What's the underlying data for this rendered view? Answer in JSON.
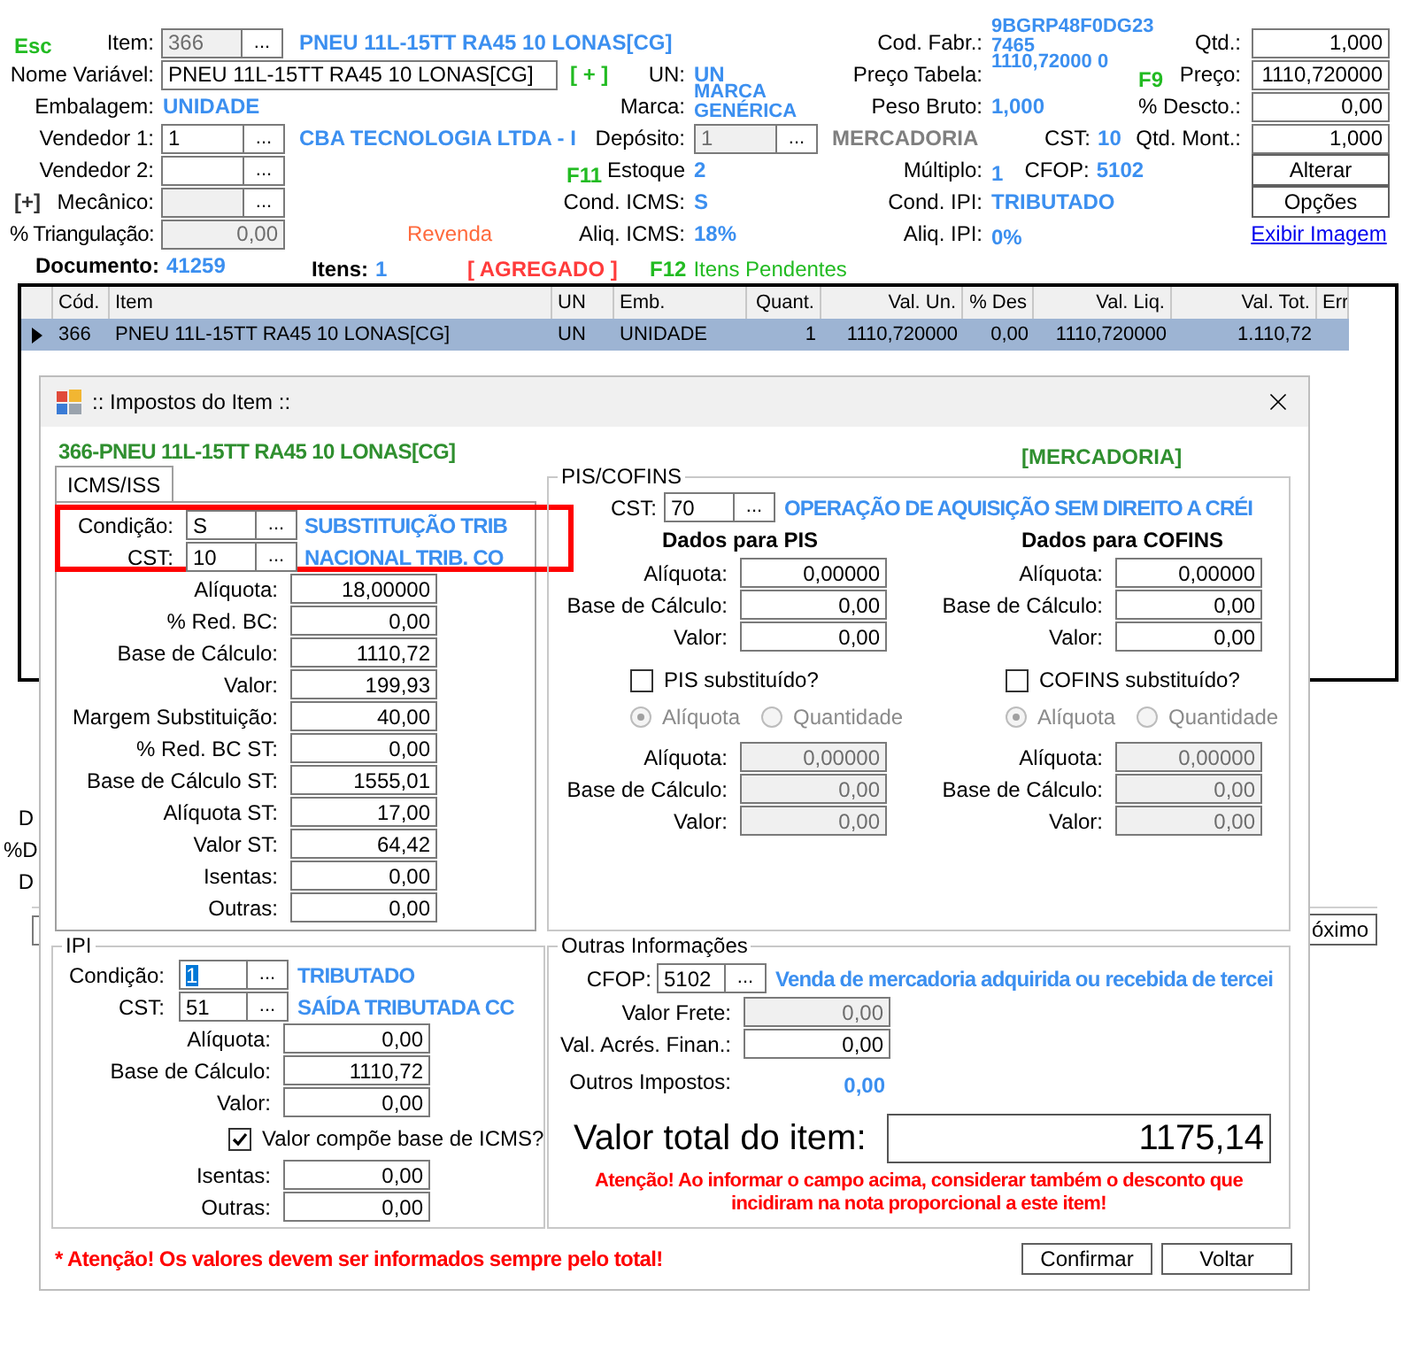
{
  "main": {
    "esc_key": "Esc",
    "item": {
      "label": "Item:",
      "value": "366",
      "button": "...",
      "disabled": true,
      "description": "PNEU 11L-15TT RA45 10 LONAS[CG]"
    },
    "cod_fabr": {
      "label": "Cod. Fabr.:",
      "value": "9BGRP48F0DG23 7465"
    },
    "qtd": {
      "label": "Qtd.:",
      "value": "1,000"
    },
    "nome_variavel": {
      "label": "Nome Variável:",
      "value": "PNEU 11L-15TT RA45 10 LONAS[CG]"
    },
    "plus_key": "[ + ]",
    "un": {
      "label": "UN:",
      "value": "UN"
    },
    "preco_tabela": {
      "label": "Preço Tabela:",
      "value": "1110,72000 0"
    },
    "f9_key": "F9",
    "preco": {
      "label": "Preço:",
      "value": "1110,720000"
    },
    "embalagem": {
      "label": "Embalagem:",
      "value": "UNIDADE"
    },
    "marca": {
      "label": "Marca:",
      "value": "MARCA GENÉRICA"
    },
    "peso_bruto": {
      "label": "Peso Bruto:",
      "value": "1,000"
    },
    "desconto": {
      "label": "% Descto.:",
      "value": "0,00"
    },
    "vendedor_1": {
      "label": "Vendedor 1:",
      "value": "1",
      "button": "...",
      "disabled": false,
      "description": "CBA TECNOLOGIA LTDA - I"
    },
    "deposito": {
      "label": "Depósito:",
      "value": "1",
      "button": "...",
      "disabled": true,
      "description": "MERCADORIA"
    },
    "cst": {
      "label": "CST:",
      "value": "10"
    },
    "qtd_mont": {
      "label": "Qtd. Mont.:",
      "value": "1,000"
    },
    "vendedor_2": {
      "label": "Vendedor 2:",
      "button": "...",
      "disabled": false
    },
    "f11_key": "F11",
    "estoque": {
      "label": "Estoque",
      "value": "2"
    },
    "multiplo": {
      "label": "Múltiplo:",
      "value": "1"
    },
    "cfop": {
      "label": "CFOP:",
      "value": "5102"
    },
    "alterar_button": "Alterar",
    "expand_key": "[+]",
    "mecanico": {
      "label": "Mecânico:",
      "button": "...",
      "disabled": true
    },
    "cond_icms": {
      "label": "Cond. ICMS:",
      "value": "S"
    },
    "cond_ipi": {
      "label": "Cond. IPI:",
      "value": "TRIBUTADO"
    },
    "opcoes_button": "Opções",
    "triangulacao": {
      "label": "% Triangulação:",
      "value": "0,00",
      "disabled": true
    },
    "revenda": "Revenda",
    "aliq_icms": {
      "label": "Aliq. ICMS:",
      "value": "18%"
    },
    "aliq_ipi": {
      "label": "Aliq. IPI:",
      "value": "0%"
    },
    "exibir_imagem_link": "Exibir Imagem",
    "documento": {
      "label": "Documento:",
      "value": "41259"
    },
    "itens": {
      "label": "Itens:",
      "value": "1"
    },
    "agregado": "[ AGREGADO ]",
    "f12_key": "F12",
    "itens_pendentes": "Itens Pendentes"
  },
  "grid": {
    "columns": [
      "Cód.",
      "Item",
      "UN",
      "Emb.",
      "Quant.",
      "Val. Un.",
      "% Des",
      "Val. Liq.",
      "Val. Tot.",
      "Err"
    ],
    "rows": [
      {
        "selected": true,
        "cells": [
          "366",
          "PNEU 11L-15TT RA45 10 LONAS[CG]",
          "UN",
          "UNIDADE",
          "1",
          "1110,720000",
          "0,00",
          "1110,720000",
          "1.110,72"
        ]
      }
    ]
  },
  "background_fragments": {
    "labels": [
      "D",
      "%D",
      "D"
    ],
    "next_button": "óximo"
  },
  "dialog": {
    "title": ":: Impostos do Item ::",
    "item_heading": "366-PNEU 11L-15TT RA45 10 LONAS[CG]",
    "classification": "[MERCADORIA]",
    "tabs": [
      {
        "label": "ICMS/ISS",
        "selected": true
      }
    ],
    "icms": {
      "condicao": {
        "label": "Condição:",
        "value": "S",
        "button": "...",
        "description": "SUBSTITUIÇÃO TRIB"
      },
      "cst": {
        "label": "CST:",
        "value": "10",
        "button": "...",
        "description": "NACIONAL TRIB. CO"
      },
      "fields": [
        {
          "label": "Alíquota:",
          "value": "18,00000"
        },
        {
          "label": "% Red. BC:",
          "value": "0,00"
        },
        {
          "label": "Base de Cálculo:",
          "value": "1110,72"
        },
        {
          "label": "Valor:",
          "value": "199,93"
        },
        {
          "label": "Margem Substituição:",
          "value": "40,00"
        },
        {
          "label": "% Red. BC ST:",
          "value": "0,00"
        },
        {
          "label": "Base de Cálculo ST:",
          "value": "1555,01"
        },
        {
          "label": "Alíquota ST:",
          "value": "17,00"
        },
        {
          "label": "Valor ST:",
          "value": "64,42"
        },
        {
          "label": "Isentas:",
          "value": "0,00"
        },
        {
          "label": "Outras:",
          "value": "0,00"
        }
      ]
    },
    "pis_cofins": {
      "legend": "PIS/COFINS",
      "cst": {
        "label": "CST:",
        "value": "70",
        "button": "...",
        "description": "OPERAÇÃO DE AQUISIÇÃO SEM DIREITO A CRÉI"
      },
      "groups": [
        {
          "title": "Dados para PIS",
          "fields": [
            {
              "label": "Alíquota:",
              "value": "0,00000"
            },
            {
              "label": "Base de Cálculo:",
              "value": "0,00"
            },
            {
              "label": "Valor:",
              "value": "0,00"
            }
          ],
          "substituted": {
            "label": "PIS substituído?",
            "checked": false
          },
          "substitution": {
            "disabled": true,
            "radios": [
              {
                "label": "Alíquota",
                "selected": true
              },
              {
                "label": "Quantidade",
                "selected": false
              }
            ],
            "fields": [
              {
                "label": "Alíquota:",
                "value": "0,00000"
              },
              {
                "label": "Base de Cálculo:",
                "value": "0,00"
              },
              {
                "label": "Valor:",
                "value": "0,00"
              }
            ]
          }
        },
        {
          "title": "Dados para COFINS",
          "fields": [
            {
              "label": "Alíquota:",
              "value": "0,00000"
            },
            {
              "label": "Base de Cálculo:",
              "value": "0,00"
            },
            {
              "label": "Valor:",
              "value": "0,00"
            }
          ],
          "substituted": {
            "label": "COFINS substituído?",
            "checked": false
          },
          "substitution": {
            "disabled": true,
            "radios": [
              {
                "label": "Alíquota",
                "selected": true
              },
              {
                "label": "Quantidade",
                "selected": false
              }
            ],
            "fields": [
              {
                "label": "Alíquota:",
                "value": "0,00000"
              },
              {
                "label": "Base de Cálculo:",
                "value": "0,00"
              },
              {
                "label": "Valor:",
                "value": "0,00"
              }
            ]
          }
        }
      ]
    },
    "ipi": {
      "legend": "IPI",
      "condicao": {
        "label": "Condição:",
        "value": "1",
        "button": "...",
        "description": "TRIBUTADO",
        "text_selected": true
      },
      "cst": {
        "label": "CST:",
        "value": "51",
        "button": "...",
        "description": "SAÍDA TRIBUTADA CC"
      },
      "fields": [
        {
          "label": "Alíquota:",
          "value": "0,00"
        },
        {
          "label": "Base de Cálculo:",
          "value": "1110,72"
        },
        {
          "label": "Valor:",
          "value": "0,00"
        }
      ],
      "compoe": {
        "label": "Valor compõe base de ICMS?",
        "checked": true
      },
      "extra_fields": [
        {
          "label": "Isentas:",
          "value": "0,00"
        },
        {
          "label": "Outras:",
          "value": "0,00"
        }
      ]
    },
    "outras": {
      "legend": "Outras Informações",
      "cfop": {
        "label": "CFOP:",
        "value": "5102",
        "button": "...",
        "description": "Venda de mercadoria adquirida ou recebida de tercei"
      },
      "fields": [
        {
          "label": "Valor Frete:",
          "value": "0,00",
          "disabled": true
        },
        {
          "label": "Val. Acrés. Finan.:",
          "value": "0,00",
          "disabled": false
        }
      ],
      "outros_impostos": {
        "label": "Outros Impostos:",
        "value": "0,00"
      },
      "total": {
        "label": "Valor total do item:",
        "value": "1175,14"
      },
      "warning": "Atenção! Ao informar o campo acima, considerar também o desconto que incidiram na nota proporcional a este item!"
    },
    "footer_warning": "* Atenção! Os valores devem ser informados sempre pelo total!",
    "buttons": [
      "Confirmar",
      "Voltar"
    ]
  }
}
